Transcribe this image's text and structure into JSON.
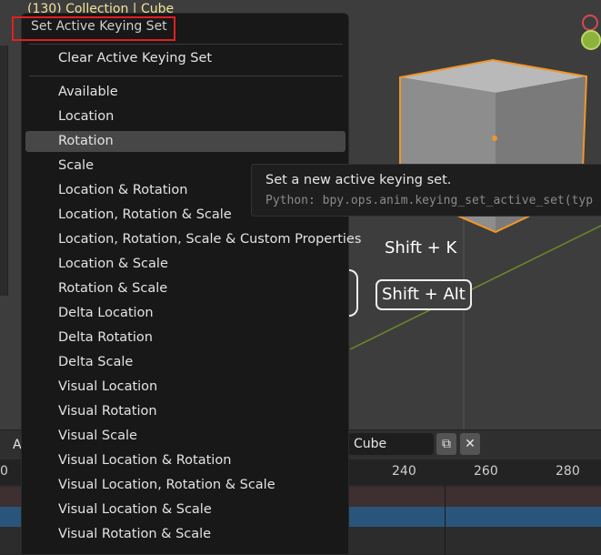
{
  "viewport": {
    "header_text": "(130) Collection | Cube",
    "shortcut_1": "Shift + K",
    "shortcut_2": "Shift + Alt"
  },
  "timeline": {
    "left_label": "A",
    "object_field": "Cube",
    "copy_icon": "copy-icon",
    "close_icon": "close-icon",
    "ruler": [
      "0",
      "240",
      "260",
      "280"
    ]
  },
  "menu": {
    "title": "Set Active Keying Set",
    "clear_item": "Clear Active Keying Set",
    "items": [
      "Available",
      "Location",
      "Rotation",
      "Scale",
      "Location & Rotation",
      "Location, Rotation & Scale",
      "Location, Rotation, Scale & Custom Properties",
      "Location & Scale",
      "Rotation & Scale",
      "Delta Location",
      "Delta Rotation",
      "Delta Scale",
      "Visual Location",
      "Visual Rotation",
      "Visual Scale",
      "Visual Location & Rotation",
      "Visual Location, Rotation & Scale",
      "Visual Location & Scale",
      "Visual Rotation & Scale"
    ],
    "active_item": "Rotation"
  },
  "tooltip": {
    "description": "Set a new active keying set.",
    "python": "Python: bpy.ops.anim.keying_set_active_set(typ"
  },
  "colors": {
    "menu_bg": "#181818",
    "highlight": "#e02020",
    "selection_outline": "#f0962a"
  }
}
